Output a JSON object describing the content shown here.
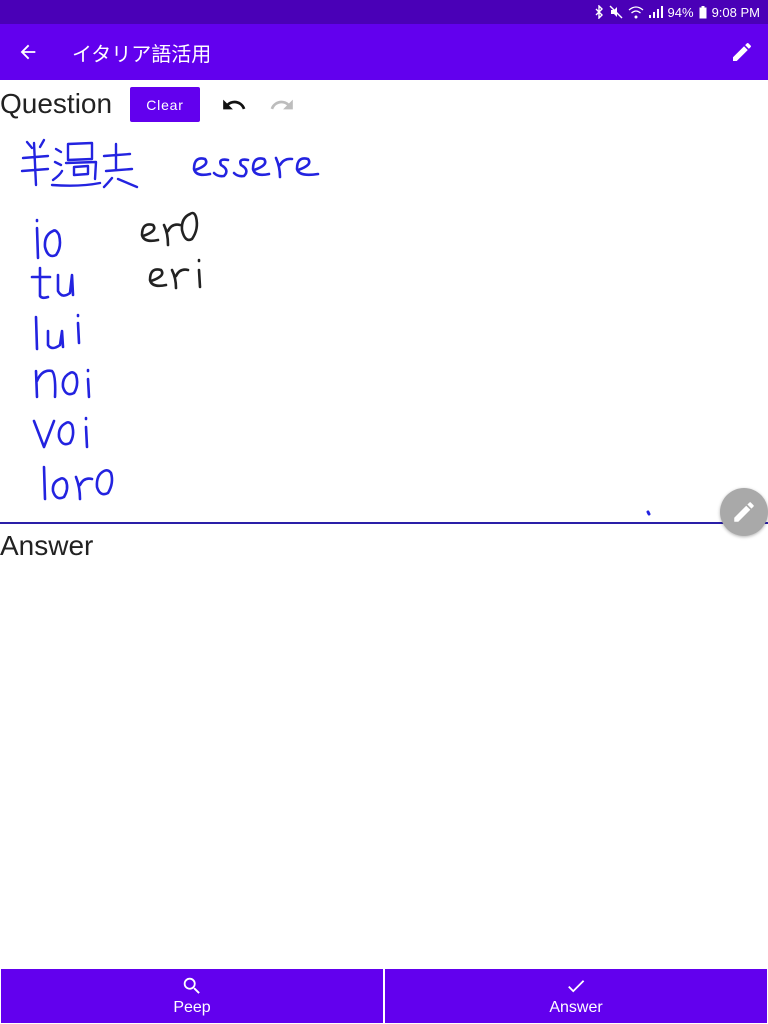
{
  "status_bar": {
    "battery": "94%",
    "time": "9:08 PM",
    "icons": [
      "bluetooth-icon",
      "mute-icon",
      "wifi-icon",
      "signal-icon",
      "battery-icon"
    ]
  },
  "app_bar": {
    "title": "イタリア語活用",
    "back_icon": "arrow-back-icon",
    "action_icon": "pencil-icon"
  },
  "question": {
    "label": "Question",
    "clear_label": "Clear",
    "undo_icon": "undo-icon",
    "redo_icon": "redo-icon",
    "handwriting": {
      "heading": "半過去 essere",
      "pronouns": [
        "io",
        "tu",
        "lui",
        "noi",
        "voi",
        "loro"
      ],
      "answers_written": [
        "ero",
        "eri"
      ]
    }
  },
  "answer": {
    "label": "Answer"
  },
  "floating_button": {
    "icon": "pencil-icon"
  },
  "bottom_bar": {
    "peep_label": "Peep",
    "peep_icon": "search-icon",
    "answer_label": "Answer",
    "answer_icon": "check-icon"
  },
  "colors": {
    "primary": "#6200ee",
    "status_bar": "#4a00b7",
    "ink_blue": "#2323e0",
    "ink_black": "#222222"
  }
}
